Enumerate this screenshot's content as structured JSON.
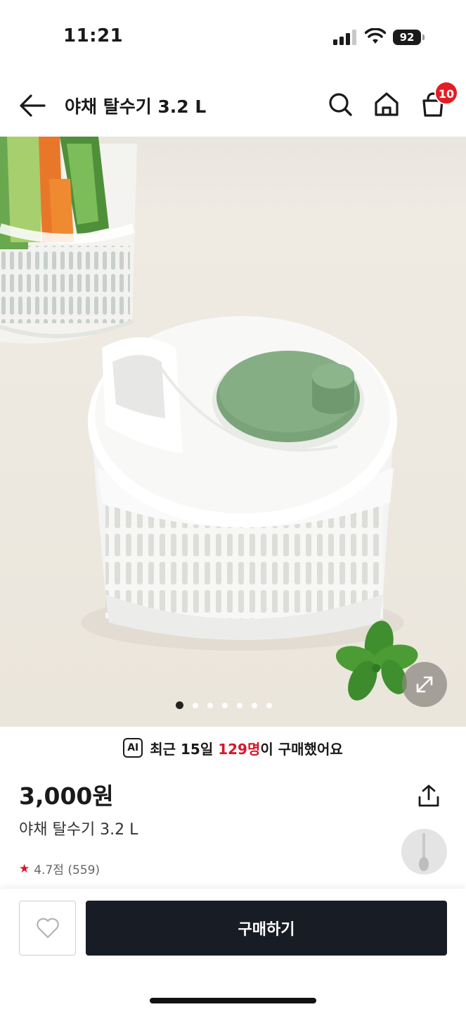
{
  "status_bar": {
    "time": "11:21",
    "battery": "92"
  },
  "header": {
    "title": "야채 탈수기 3.2 L",
    "cart_count": "10"
  },
  "image_gallery": {
    "total_images": 7,
    "current_index": 1
  },
  "ai_banner": {
    "badge": "AI",
    "prefix": "최근 15일 ",
    "highlight": "129명",
    "suffix": "이 구매했어요"
  },
  "product": {
    "price": "3,000원",
    "name": "야채 탈수기 3.2 L",
    "rating_text": "4.7점 (559)"
  },
  "actions": {
    "buy_label": "구매하기"
  },
  "colors": {
    "accent_red": "#d6172a",
    "buy_button_bg": "#181c25",
    "spinner_green": "#7aa37a"
  },
  "icons": [
    "back-arrow-icon",
    "search-icon",
    "home-icon",
    "cart-icon",
    "expand-icon",
    "share-icon",
    "heart-icon",
    "star-icon"
  ]
}
